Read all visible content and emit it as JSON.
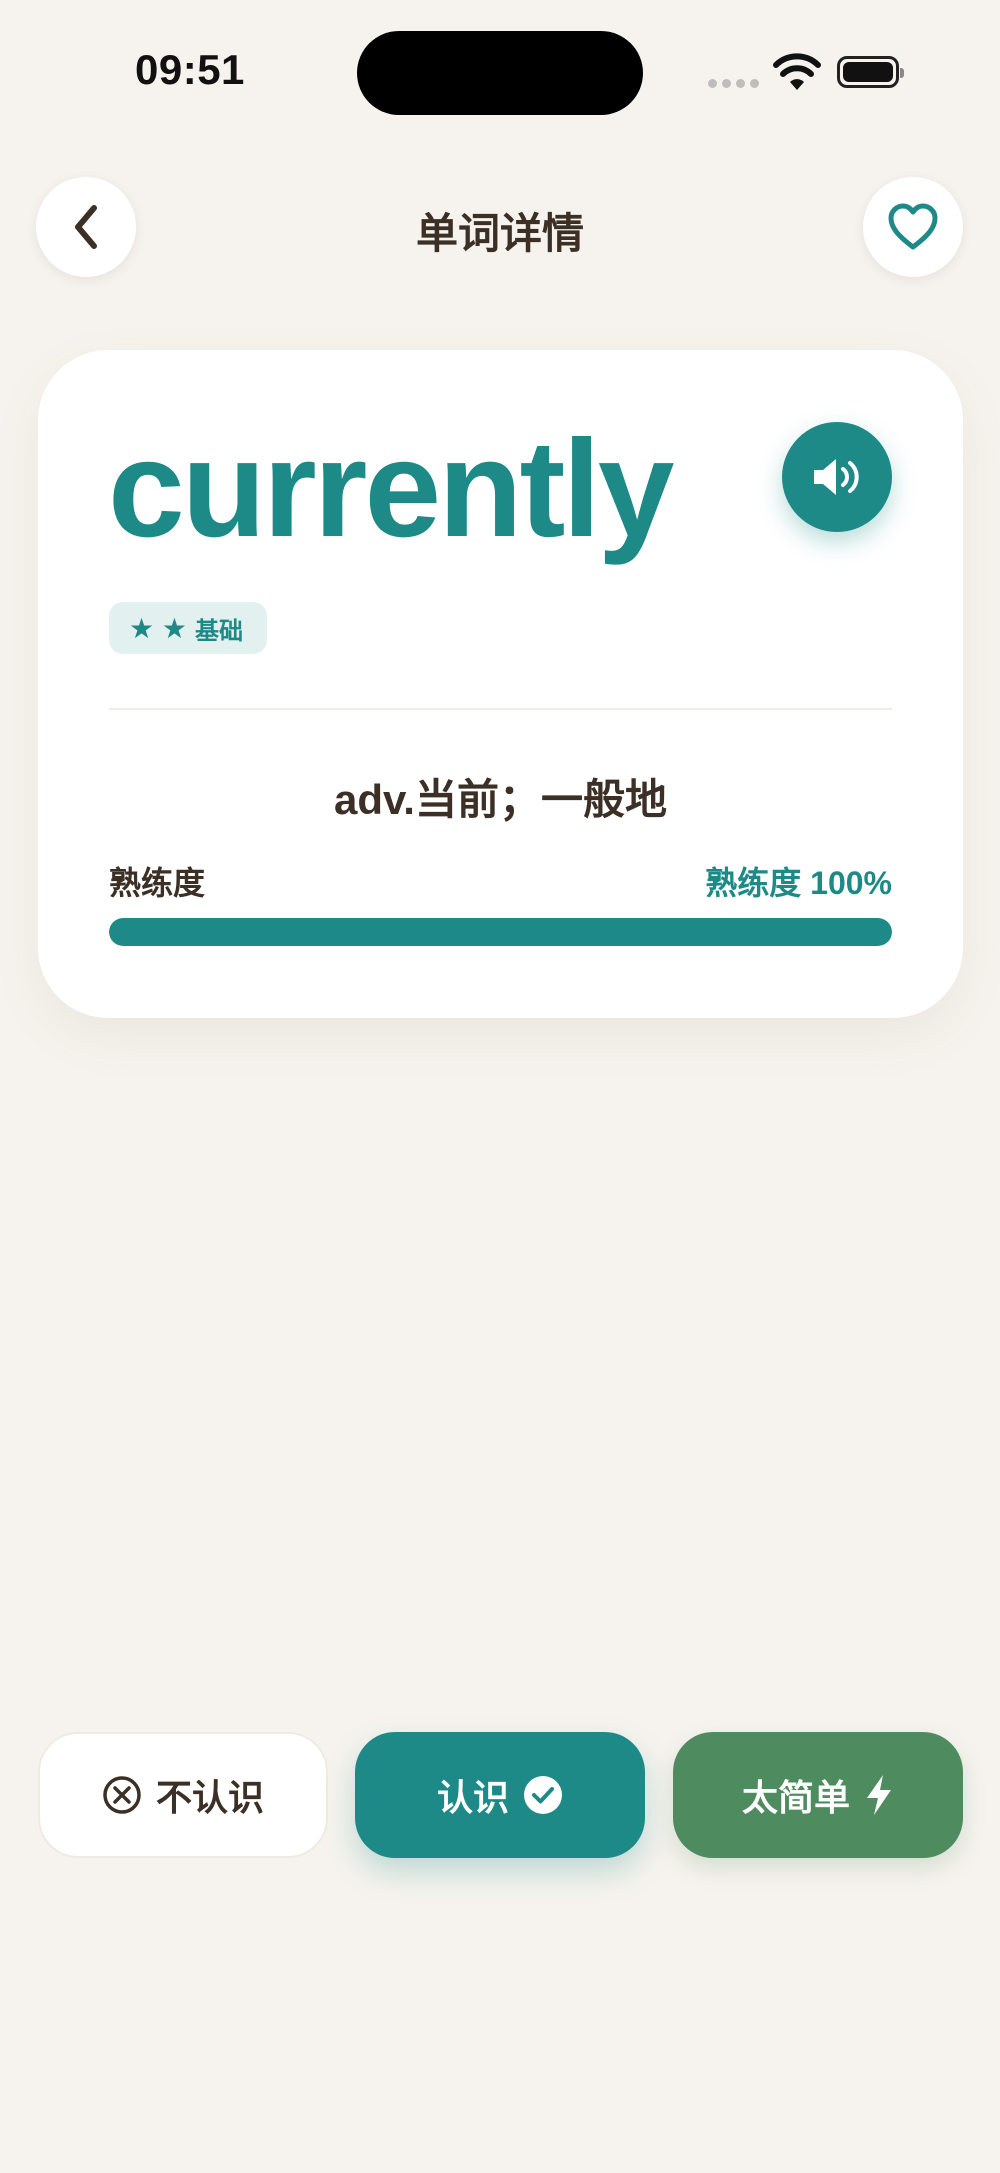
{
  "status_bar": {
    "time": "09:51"
  },
  "header": {
    "title": "单词详情"
  },
  "card": {
    "word": "currently",
    "level": {
      "stars": "★ ★",
      "label": "基础"
    },
    "definition": "adv.当前；一般地",
    "proficiency": {
      "label": "熟练度",
      "value_text": "熟练度 100%",
      "percent": 100
    }
  },
  "actions": {
    "unknown_label": "不认识",
    "known_label": "认识",
    "easy_label": "太简单"
  },
  "icons": {
    "back": "chevron-left-icon",
    "favorite": "heart-icon",
    "speaker": "speaker-icon",
    "unknown": "x-circle-icon",
    "known": "check-circle-icon",
    "easy": "lightning-icon"
  },
  "colors": {
    "accent": "#1D8A87",
    "green": "#4E8B5E",
    "background": "#F6F3EE",
    "text": "#3B2F26"
  }
}
